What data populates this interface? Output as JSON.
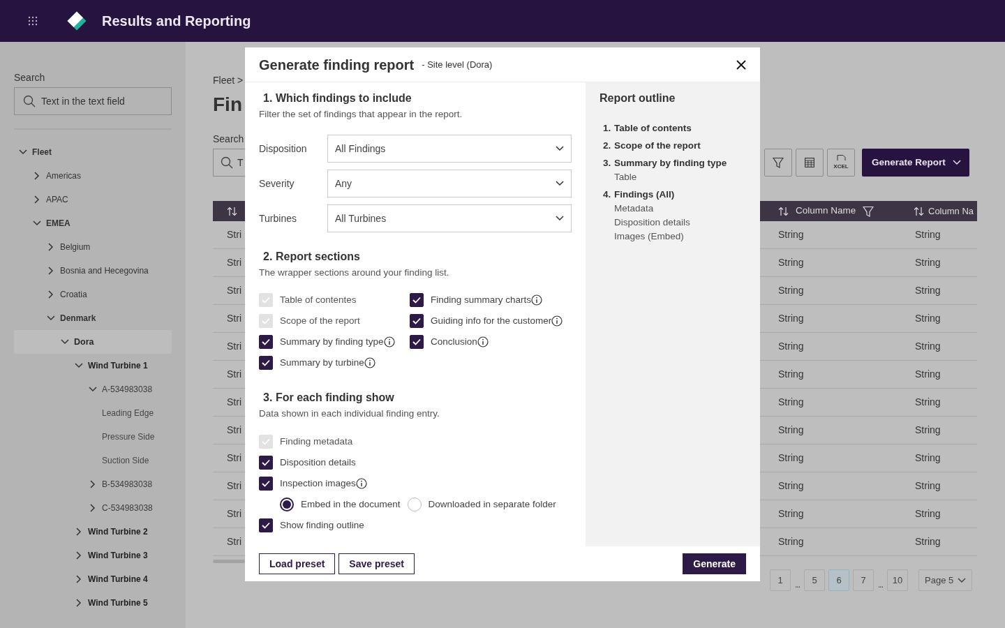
{
  "app": {
    "title": "Results and Reporting"
  },
  "sidebar": {
    "search_label": "Search",
    "search_value": "Text in the text field",
    "tree": [
      {
        "label": "Fleet",
        "kind": "group",
        "expanded": true,
        "selected": false,
        "children": [
          {
            "label": "Americas",
            "kind": "group",
            "expanded": false,
            "selected": false
          },
          {
            "label": "APAC",
            "kind": "group",
            "expanded": false,
            "selected": false
          },
          {
            "label": "EMEA",
            "kind": "group",
            "expanded": true,
            "selected": false,
            "children": [
              {
                "label": "Belgium",
                "kind": "group",
                "expanded": false,
                "selected": false
              },
              {
                "label": "Bosnia and Hecegovina",
                "kind": "group",
                "expanded": false,
                "selected": false
              },
              {
                "label": "Croatia",
                "kind": "group",
                "expanded": false,
                "selected": false
              },
              {
                "label": "Denmark",
                "kind": "group",
                "expanded": true,
                "selected": false,
                "children": [
                  {
                    "label": "Dora",
                    "kind": "site",
                    "expanded": true,
                    "selected": true,
                    "children": [
                      {
                        "label": "Wind Turbine 1",
                        "kind": "turbine",
                        "expanded": true,
                        "selected": false,
                        "children": [
                          {
                            "label": "A-534983038",
                            "kind": "blade",
                            "expanded": true,
                            "selected": false,
                            "children": [
                              {
                                "label": "Leading Edge",
                                "kind": "part",
                                "selected": false
                              },
                              {
                                "label": "Pressure Side",
                                "kind": "part",
                                "selected": false
                              },
                              {
                                "label": "Suction Side",
                                "kind": "part",
                                "selected": false
                              }
                            ]
                          },
                          {
                            "label": "B-534983038",
                            "kind": "blade",
                            "expanded": false,
                            "selected": false
                          },
                          {
                            "label": "C-534983038",
                            "kind": "blade",
                            "expanded": false,
                            "selected": false
                          }
                        ]
                      },
                      {
                        "label": "Wind Turbine 2",
                        "kind": "turbine",
                        "expanded": false,
                        "selected": false
                      },
                      {
                        "label": "Wind Turbine 3",
                        "kind": "turbine",
                        "expanded": false,
                        "selected": false
                      },
                      {
                        "label": "Wind Turbine 4",
                        "kind": "turbine",
                        "expanded": false,
                        "selected": false
                      },
                      {
                        "label": "Wind Turbine 5",
                        "kind": "turbine",
                        "expanded": false,
                        "selected": false
                      }
                    ]
                  }
                ]
              }
            ]
          }
        ]
      }
    ]
  },
  "page": {
    "breadcrumb": "Fleet >",
    "title": "Fin",
    "search_label": "Search",
    "search_value": "T",
    "toolbar": {
      "export_icon_text": "XCEL",
      "primary": "Generate Report"
    },
    "table": {
      "columns": [
        {
          "filter": false
        },
        {
          "label": "Column Name",
          "filter": true
        },
        {
          "label": "Column Na",
          "filter": false
        }
      ],
      "rows": [
        [
          "Stri",
          "String",
          "String"
        ],
        [
          "Stri",
          "String",
          "String"
        ],
        [
          "Stri",
          "String",
          "String"
        ],
        [
          "Stri",
          "String",
          "String"
        ],
        [
          "Stri",
          "String",
          "String"
        ],
        [
          "Stri",
          "String",
          "String"
        ],
        [
          "Stri",
          "String",
          "String"
        ],
        [
          "Stri",
          "String",
          "String"
        ],
        [
          "Stri",
          "String",
          "String"
        ],
        [
          "Stri",
          "String",
          "String"
        ],
        [
          "Stri",
          "String",
          "String"
        ],
        [
          "Stri",
          "String",
          "String"
        ]
      ]
    },
    "pagination": {
      "pages": [
        {
          "kind": "page",
          "label": "1",
          "selected": false
        },
        {
          "kind": "ellipsis",
          "label": "..."
        },
        {
          "kind": "page",
          "label": "5",
          "selected": false
        },
        {
          "kind": "page",
          "label": "6",
          "selected": true
        },
        {
          "kind": "page",
          "label": "7",
          "selected": false
        },
        {
          "kind": "ellipsis",
          "label": "..."
        },
        {
          "kind": "page",
          "label": "10",
          "selected": false
        }
      ],
      "page_select": "Page 5"
    }
  },
  "dialog": {
    "title": "Generate finding report",
    "subtitle": "- Site level (Dora)",
    "sections": [
      {
        "kind": "filters",
        "number": "1.",
        "title": "Which findings to include",
        "description": "Filter the set of findings that appear in the report.",
        "filters": [
          {
            "label": "Disposition",
            "value": "All Findings"
          },
          {
            "label": "Severity",
            "value": "Any"
          },
          {
            "label": "Turbines",
            "value": "All Turbines"
          }
        ]
      },
      {
        "kind": "grid",
        "number": "2.",
        "title": "Report sections",
        "description": "The wrapper sections around your finding list.",
        "options": [
          {
            "kind": "checkbox",
            "label": "Table of contentes",
            "checked": true,
            "disabled": true,
            "info": false
          },
          {
            "kind": "checkbox",
            "label": "Finding summary charts",
            "checked": true,
            "disabled": false,
            "info": true
          },
          {
            "kind": "checkbox",
            "label": "Scope of the report",
            "checked": true,
            "disabled": true,
            "info": false
          },
          {
            "kind": "checkbox",
            "label": "Guiding info for the customer",
            "checked": true,
            "disabled": false,
            "info": true
          },
          {
            "kind": "checkbox",
            "label": "Summary by finding type",
            "checked": true,
            "disabled": false,
            "info": true
          },
          {
            "kind": "checkbox",
            "label": "Conclusion",
            "checked": true,
            "disabled": false,
            "info": true
          },
          {
            "kind": "checkbox",
            "label": "Summary by turbine",
            "checked": true,
            "disabled": false,
            "info": true
          }
        ]
      },
      {
        "kind": "list",
        "number": "3.",
        "title": "For each finding show",
        "description": "Data shown in each individual finding entry.",
        "options": [
          {
            "kind": "checkbox",
            "label": "Finding metadata",
            "checked": true,
            "disabled": true,
            "info": false
          },
          {
            "kind": "checkbox",
            "label": "Disposition details",
            "checked": true,
            "disabled": false,
            "info": false
          },
          {
            "kind": "checkbox",
            "label": "Inspection images",
            "checked": true,
            "disabled": false,
            "info": true
          },
          {
            "kind": "radios",
            "choices": [
              {
                "label": "Embed in the document",
                "selected": true
              },
              {
                "label": "Downloaded in separate folder",
                "selected": false
              }
            ]
          },
          {
            "kind": "checkbox",
            "label": "Show finding outline",
            "checked": true,
            "disabled": false,
            "info": false
          }
        ]
      }
    ],
    "outline": {
      "title": "Report outline",
      "items": [
        {
          "number": "1.",
          "title": "Table of contents"
        },
        {
          "number": "2.",
          "title": "Scope of the report"
        },
        {
          "number": "3.",
          "title": "Summary by finding type",
          "details": [
            "Table"
          ]
        },
        {
          "number": "4.",
          "title": "Findings (All)",
          "details": [
            "Metadata",
            "Disposition details",
            "Images (Embed)"
          ]
        }
      ]
    },
    "buttons": [
      {
        "kind": "outline",
        "label": "Load preset"
      },
      {
        "kind": "outline",
        "label": "Save preset"
      },
      {
        "kind": "primary",
        "label": "Generate"
      }
    ]
  }
}
